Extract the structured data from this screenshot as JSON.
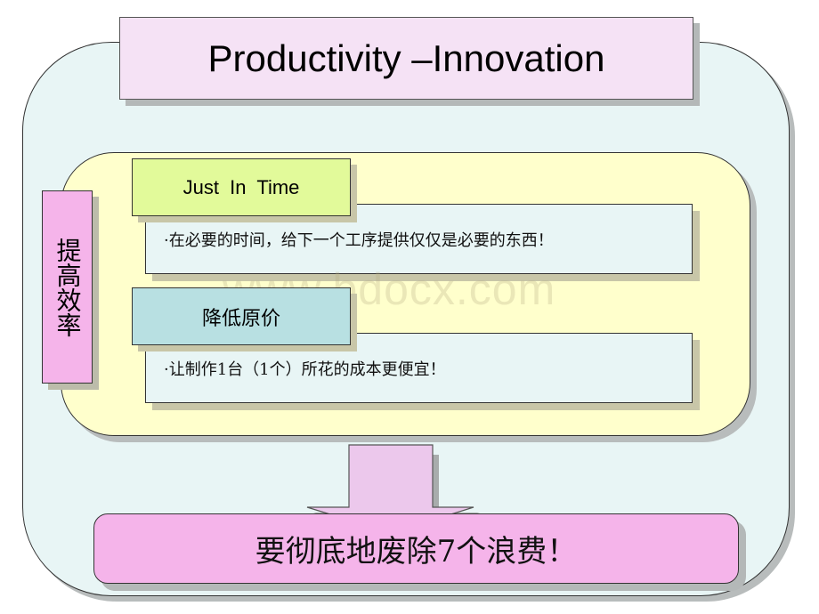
{
  "title": "Productivity –Innovation",
  "side_label": "提高效率",
  "sections": [
    {
      "header": "Just  In  Time",
      "bullet": "·在必要的时间，给下一个工序提供仅仅是必要的东西！"
    },
    {
      "header": "降低原价",
      "bullet": "·让制作1台（1个）所花的成本更便宜！"
    }
  ],
  "conclusion": "要彻底地废除7个浪费！",
  "watermark": "www.bdocx.com",
  "colors": {
    "outer_bg": "#e8f5f5",
    "title_bg": "#f5e2f5",
    "inner_bg": "#ffffcc",
    "side_bg": "#f5b4ea",
    "jit_header_bg": "#e2fa9a",
    "cost_header_bg": "#b8e0e2",
    "conclusion_bg": "#f5b4ea",
    "arrow_fill": "#ecc8ec"
  }
}
